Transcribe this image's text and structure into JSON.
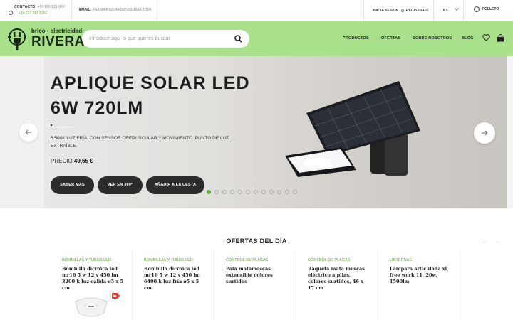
{
  "topbar": {
    "contact_label": "CONTACTO:",
    "phone1": "+34 960 621 024",
    "phone2": "+34 627 097 6261",
    "email_label": "EMAIL:",
    "email": "ANABELRIVERA1865@GMAIL.COM",
    "login": "INICIA SESION",
    "register": "REGISTRATE",
    "language": "ES",
    "folleto": "FOLLETO"
  },
  "header": {
    "logo_line1": "brico · electricidad",
    "logo_line2": "RIVERA",
    "search_placeholder": "Introduce aquí lo que quieres buscar",
    "nav": [
      "PRODUCTOS",
      "OFERTAS",
      "SOBRE NOSOTROS",
      "BLOG"
    ],
    "icons": [
      "search-icon",
      "heart-icon",
      "cart-icon"
    ]
  },
  "hero": {
    "title_line1": "APLIQUE SOLAR LED",
    "title_line2": "6W 720LM",
    "description": "6.500K LUZ FRÍA. CON SENSOR CREPUSCULAR Y MOVIMIENTO. PUNTO DE LUZ EXTRAÍBLE.",
    "price_label": "PRECIO",
    "price_value": "49,65 €",
    "buttons": [
      "SABER MÁS",
      "VER EN 360º",
      "AÑADIR A LA CESTA"
    ],
    "slide_count": 12,
    "active_slide": 1
  },
  "offers": {
    "title": "OFERTAS DEL DÍA",
    "cards": [
      {
        "category": "BOMBILLAS Y TUBOS LED",
        "name": "Bombilla dicroica led mr16 5 w 12 v 450 lm 3200 k luz cálida ø5 x 5 cm"
      },
      {
        "category": "BOMBILLAS Y TUBOS LED",
        "name": "Bombilla dicroica led mr16 5 w 12 v 450 lm 6400 k luz fría ø5 x 5 cm"
      },
      {
        "category": "CONTROL DE PLAGAS",
        "name": "Pala matamoscas extensible colores surtidos"
      },
      {
        "category": "CONTROL DE PLAGAS",
        "name": "Raqueta mata moscas eléctrico a pilas, colores surtidos, 46 x 17 cm"
      },
      {
        "category": "LINTERNAS",
        "name": "Lámpara articulada xl, free work 11, 20w, 1500lm"
      }
    ]
  },
  "colors": {
    "brand_green": "#a8e08b",
    "accent_green": "#5ab03a",
    "dark_button": "#2c2c2c"
  }
}
